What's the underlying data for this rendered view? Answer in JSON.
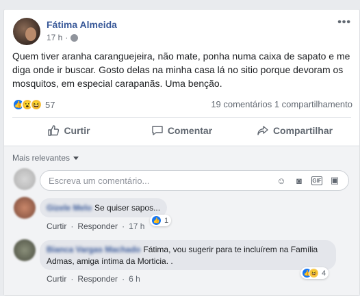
{
  "post": {
    "author": "Fátima Almeida",
    "time": "17 h",
    "privacy_icon": "globe-icon",
    "text": "Quem tiver aranha caranguejeira, não mate, ponha numa caixa de sapato e me diga onde ir buscar. Gosto delas na minha casa lá no sitio porque devoram os mosquitos, em especial carapanãs. Uma benção.",
    "reactions": {
      "icons": [
        "like",
        "wow",
        "haha"
      ],
      "count": "57"
    },
    "comments_count": "19 comentários",
    "shares_count": "1 compartilhamento"
  },
  "actions": {
    "like": "Curtir",
    "comment": "Comentar",
    "share": "Compartilhar"
  },
  "comments_section": {
    "sort_label": "Mais relevantes",
    "input_placeholder": "Escreva um comentário...",
    "input_icons": [
      "emoji-icon",
      "camera-icon",
      "gif-icon",
      "sticker-icon"
    ]
  },
  "comments": [
    {
      "name": "Gizele Melo",
      "text": "Se quiser sapos...",
      "like_label": "Curtir",
      "reply_label": "Responder",
      "time": "17 h",
      "reaction_count": "1"
    },
    {
      "name": "Bianca Vargas Machado",
      "text": "Fátima, vou sugerir para te incluírem na Família Admas, amiga íntima da Morticia. .",
      "like_label": "Curtir",
      "reply_label": "Responder",
      "time": "6 h",
      "reaction_count": "4"
    }
  ],
  "colors": {
    "link": "#385898",
    "like_blue": "#1877f2",
    "bg": "#e9ebee"
  }
}
